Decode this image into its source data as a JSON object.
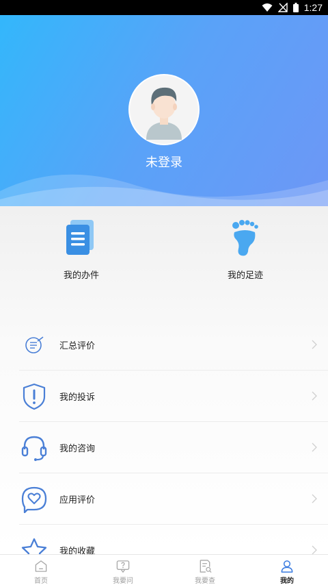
{
  "status_bar": {
    "time": "1:27"
  },
  "profile": {
    "username": "未登录"
  },
  "quick_actions": [
    {
      "label": "我的办件",
      "icon": "documents-icon"
    },
    {
      "label": "我的足迹",
      "icon": "footprint-icon"
    }
  ],
  "menu": [
    {
      "label": "汇总评价",
      "icon": "summary-evaluation-icon"
    },
    {
      "label": "我的投诉",
      "icon": "shield-alert-icon"
    },
    {
      "label": "我的咨询",
      "icon": "headset-icon"
    },
    {
      "label": "应用评价",
      "icon": "heart-chat-icon"
    },
    {
      "label": "我的收藏",
      "icon": "star-icon"
    }
  ],
  "tabs": [
    {
      "label": "首页",
      "icon": "home-icon",
      "active": false
    },
    {
      "label": "我要问",
      "icon": "question-chat-icon",
      "active": false
    },
    {
      "label": "我要查",
      "icon": "search-document-icon",
      "active": false
    },
    {
      "label": "我的",
      "icon": "user-icon",
      "active": true
    }
  ],
  "colors": {
    "header_start": "#33b7fb",
    "header_end": "#6d97f6",
    "accent": "#4a7fd6",
    "active_tab": "#3a7be0"
  }
}
